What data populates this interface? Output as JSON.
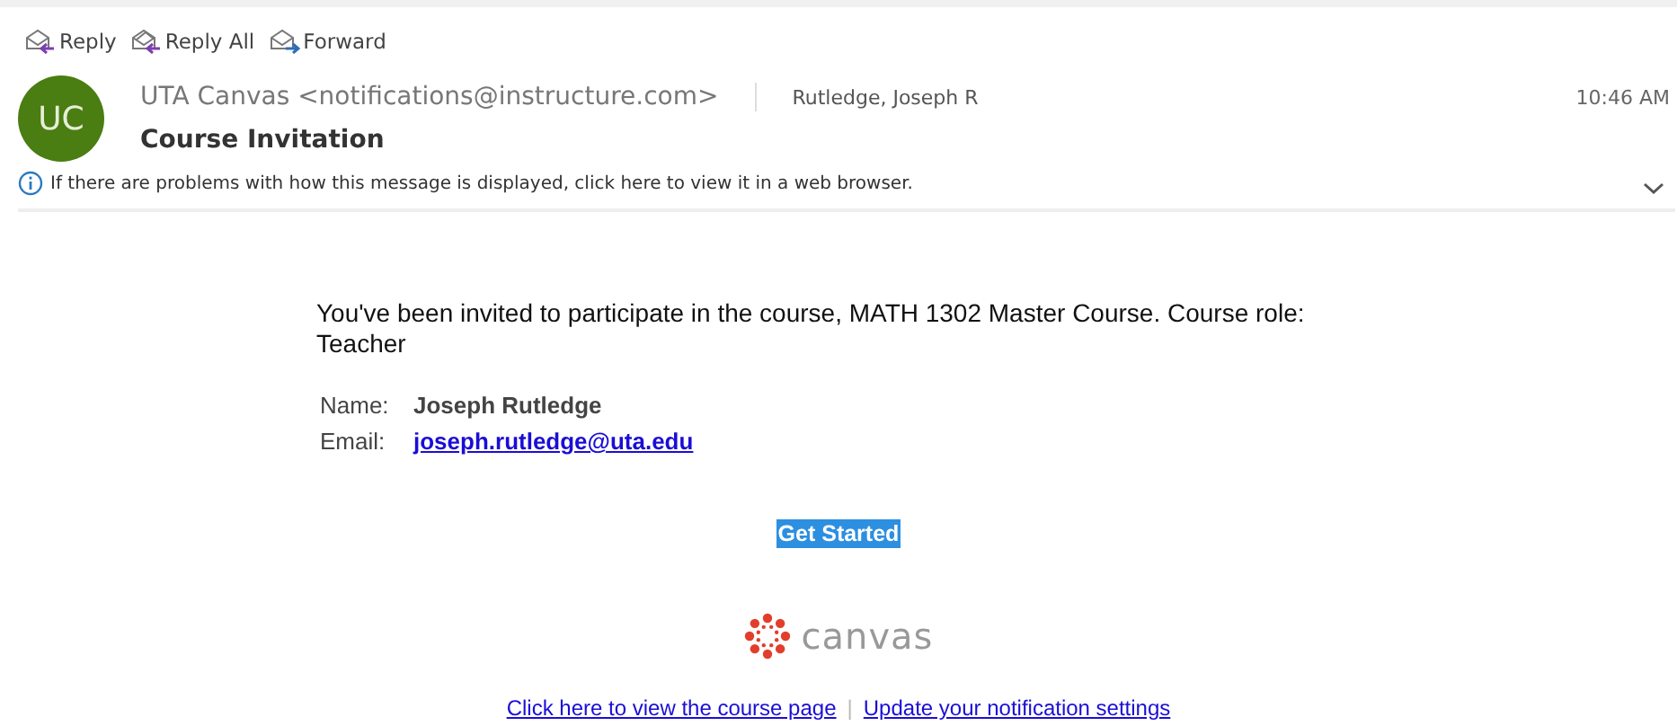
{
  "toolbar": [
    {
      "kind": "reply",
      "label": "Reply"
    },
    {
      "kind": "reply-all",
      "label": "Reply All"
    },
    {
      "kind": "forward",
      "label": "Forward"
    }
  ],
  "message": {
    "avatar_initials": "UC",
    "sender": "UTA Canvas <notifications@instructure.com>",
    "recipient": "Rutledge, Joseph R",
    "time": "10:46 AM",
    "subject": "Course Invitation",
    "info_bar": "If there are problems with how this message is displayed, click here to view it in a web browser."
  },
  "body": {
    "intro": "You've been invited to participate in the course, MATH 1302 Master Course. Course role: Teacher",
    "details": [
      {
        "kind": "text",
        "label": "Name:",
        "value": "Joseph Rutledge"
      },
      {
        "kind": "link",
        "label": "Email:",
        "value": "joseph.rutledge@uta.edu"
      }
    ],
    "button": "Get Started",
    "logo_text": "canvas",
    "footer_links": [
      "Click here to view the course page",
      "Update your notification settings"
    ],
    "footer_separator": "|"
  }
}
